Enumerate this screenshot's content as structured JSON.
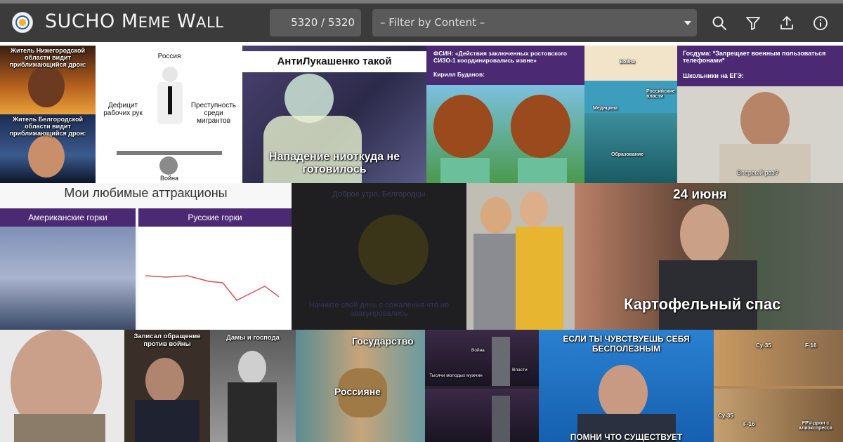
{
  "header": {
    "brand_main": "SUCHO",
    "brand_m": "M",
    "brand_eme": "EME",
    "brand_w": "W",
    "brand_all": "ALL",
    "counter": "5320 / 5320",
    "filter_placeholder": "– Filter by Content –",
    "icons": [
      "search-icon",
      "filter-icon",
      "upload-icon",
      "info-icon"
    ]
  },
  "memes": {
    "m1": {
      "top": "Житель Нижегородской области видит приближающийся дрон:",
      "bottom": "Житель Белгородской области видит приближающийся дрон:"
    },
    "m2": {
      "top": "Россия",
      "left": "Дефицит рабочих рук",
      "right": "Преступность среди мигрантов",
      "bottom": "Война"
    },
    "m3": {
      "top": "АнтиЛукашенко такой",
      "bottom": "Нападение ниоткуда не готовилось"
    },
    "m4": {
      "line1": "ФСИН: «Действия заключенных ростовского СИЗО-1 координировались извне»",
      "line2": "Кирилл Буданов:"
    },
    "m5": {
      "a": "Война",
      "b": "Российские власти",
      "c": "Медицина",
      "d": "Образование"
    },
    "m6": {
      "line1": "Госдума: *Запрещает военным пользоваться телефонами*",
      "line2": "Школьники на ЕГЭ:",
      "bottom": "Впервый раз?"
    },
    "m7": {
      "title": "Мои любимые аттракционы",
      "left": "Американские горки",
      "right": "Русские горки"
    },
    "m8": {
      "top": "Доброе утро, Белгородцы",
      "bottom": "Начните свой день с сожаления что не эвакуировались"
    },
    "m10": {
      "top": "24 июня",
      "bottom": "Картофельный спас"
    },
    "m12": {
      "top": "Записал обращение против войны"
    },
    "m13": {
      "top": "Дамы и господа"
    },
    "m14": {
      "top": "Государство",
      "bottom": "Россияне"
    },
    "m15": {
      "a": "Война",
      "b": "Власти",
      "c": "Тысячи молодых мужчин"
    },
    "m16": {
      "top": "ЕСЛИ ТЫ ЧУВСТВУЕШЬ СЕБЯ БЕСПОЛЕЗНЫМ",
      "bottom": "ПОМНИ ЧТО СУЩЕСТВУЕТ"
    },
    "m17": {
      "a": "Су-35",
      "b": "F-16",
      "c": "Су-35",
      "d": "F-16",
      "e": "FPV-дрон с алиэкспресса"
    }
  }
}
